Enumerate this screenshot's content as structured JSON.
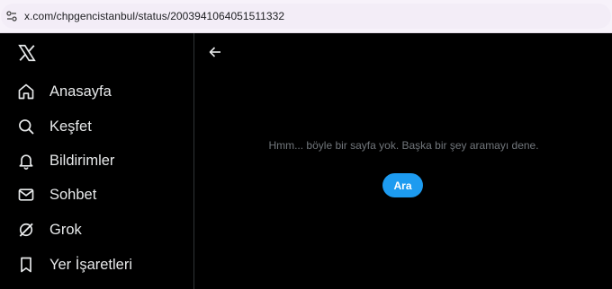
{
  "browser": {
    "url": "x.com/chpgencistanbul/status/2003941064051511332",
    "site_info_icon": "site-info-icon"
  },
  "sidebar": {
    "logo_icon": "x-logo-icon",
    "items": [
      {
        "label": "Anasayfa",
        "icon": "home-icon"
      },
      {
        "label": "Keşfet",
        "icon": "search-icon"
      },
      {
        "label": "Bildirimler",
        "icon": "bell-icon"
      },
      {
        "label": "Sohbet",
        "icon": "mail-icon"
      },
      {
        "label": "Grok",
        "icon": "grok-icon"
      },
      {
        "label": "Yer İşaretleri",
        "icon": "bookmark-icon"
      }
    ]
  },
  "main": {
    "back_icon": "back-arrow-icon",
    "message": "Hmm... böyle bir sayfa yok. Başka bir şey aramayı dene.",
    "search_button_label": "Ara"
  },
  "colors": {
    "background": "#000000",
    "text": "#e7e9ea",
    "muted": "#71767b",
    "accent": "#1d9bf0"
  }
}
